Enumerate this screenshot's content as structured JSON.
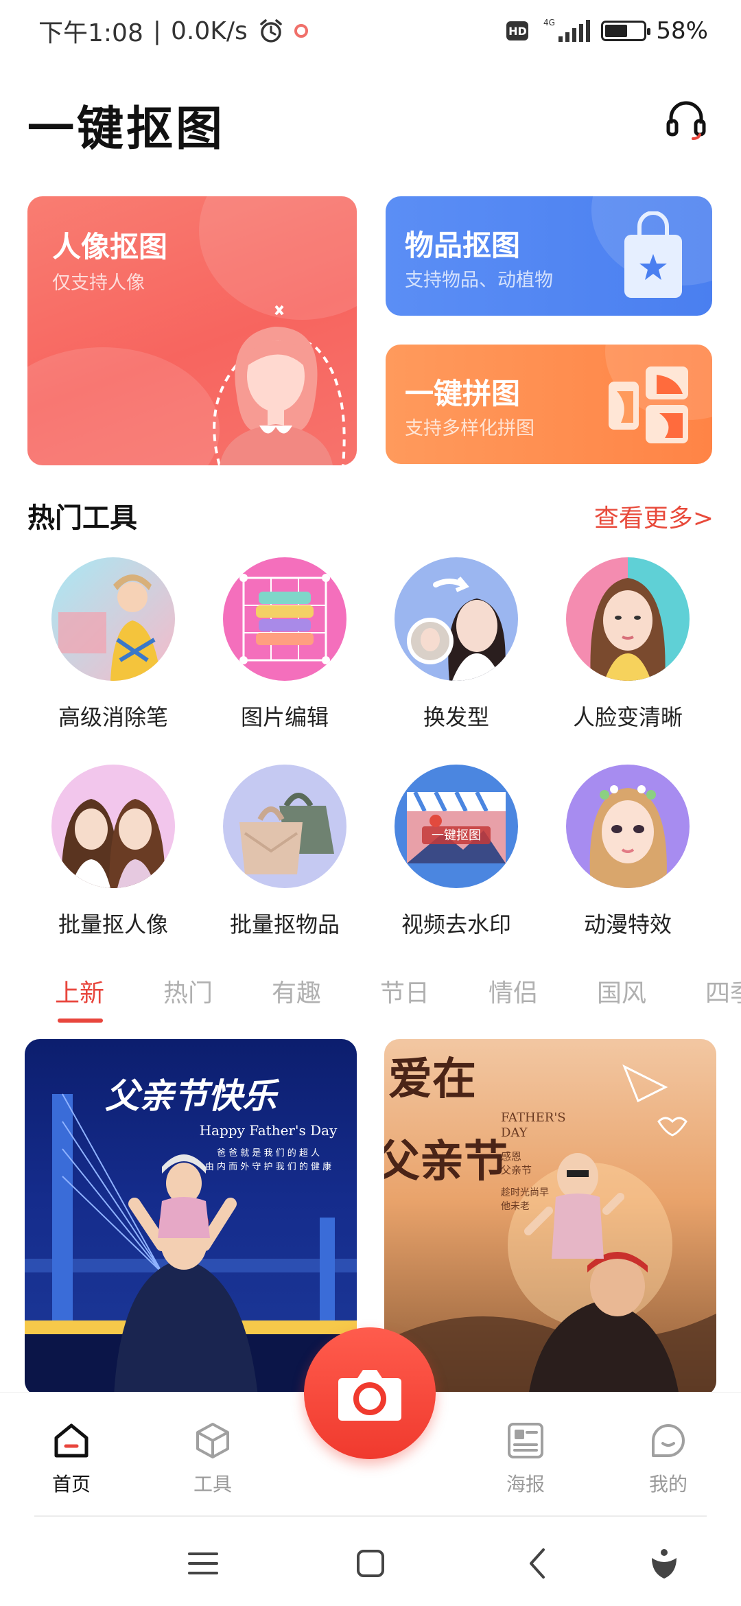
{
  "status_bar": {
    "time": "下午1:08",
    "speed": "0.0K/s",
    "network": "4G",
    "battery_text": "58%",
    "battery_level": 0.58
  },
  "header": {
    "title": "一键抠图"
  },
  "feature_cards": {
    "portrait": {
      "title": "人像抠图",
      "subtitle": "仅支持人像"
    },
    "object": {
      "title": "物品抠图",
      "subtitle": "支持物品、动植物"
    },
    "collage": {
      "title": "一键拼图",
      "subtitle": "支持多样化拼图"
    }
  },
  "hot_tools": {
    "title": "热门工具",
    "more": "查看更多>",
    "items": [
      {
        "label": "高级消除笔"
      },
      {
        "label": "图片编辑"
      },
      {
        "label": "换发型"
      },
      {
        "label": "人脸变清晰"
      },
      {
        "label": "批量抠人像"
      },
      {
        "label": "批量抠物品"
      },
      {
        "label": "视频去水印"
      },
      {
        "label": "动漫特效"
      }
    ]
  },
  "tabs": [
    "上新",
    "热门",
    "有趣",
    "节日",
    "情侣",
    "国风",
    "四季"
  ],
  "posters": {
    "left": {
      "headline": "父亲节快乐",
      "subline": "Happy Father's Day",
      "caption1": "爸 爸 就 是 我 们 的 超 人",
      "caption2": "由 内 而 外 守 护 我 们 的 健 康"
    },
    "right": {
      "headline1": "爱在",
      "headline2": "父亲节",
      "english1": "FATHER'S",
      "english2": "DAY",
      "note1": "感恩",
      "note2": "父亲节",
      "note3": "趁时光尚早",
      "note4": "他未老"
    }
  },
  "bottom_nav": {
    "home": "首页",
    "tools": "工具",
    "poster": "海报",
    "mine": "我的"
  },
  "colors": {
    "accent": "#e8453c",
    "portrait_card": "#f7655f",
    "object_card": "#4a7ff0",
    "collage_card": "#ff8446"
  }
}
